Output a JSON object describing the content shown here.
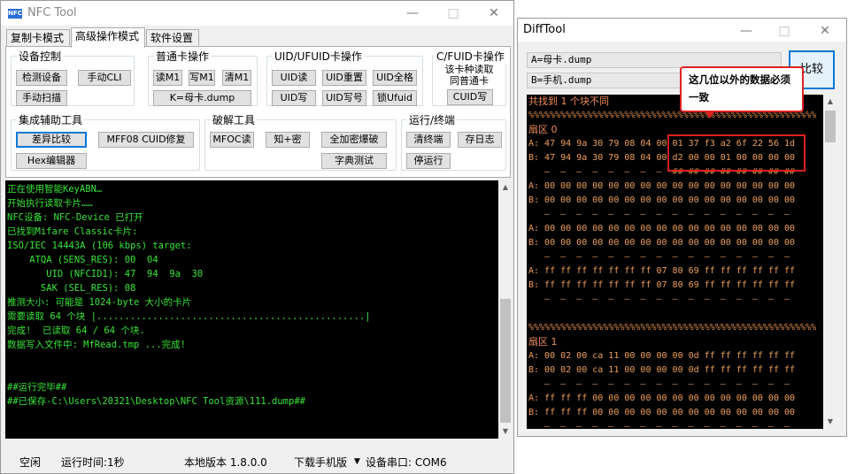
{
  "nfc": {
    "title": "NFC Tool",
    "icon_label": "NFC",
    "window_controls": [
      "—",
      "□",
      "✕"
    ],
    "tabs": [
      "复制卡模式",
      "高级操作模式",
      "软件设置"
    ],
    "groups": {
      "device": {
        "title": "设备控制",
        "buttons": [
          "检测设备",
          "手动CLI",
          "手动扫描"
        ]
      },
      "normal": {
        "title": "普通卡操作",
        "buttons": [
          "读M1",
          "写M1",
          "清M1",
          "K=母卡.dump"
        ]
      },
      "uid": {
        "title": "UID/UFUID卡操作",
        "buttons": [
          "UID读",
          "UID重置",
          "UID全格",
          "UID写",
          "UID写号",
          "锁Ufuid"
        ]
      },
      "cfuid": {
        "title": "C/FUID卡操作",
        "text_line1": "该卡种读取",
        "text_line2": "同普通卡",
        "button": "CUID写"
      },
      "integrated": {
        "title": "集成辅助工具",
        "buttons": [
          "差异比较",
          "MFF08 CUID修复",
          "Hex编辑器"
        ]
      },
      "crack": {
        "title": "破解工具",
        "buttons": [
          "MFOC读",
          "知+密",
          "全加密爆破",
          "字典测试"
        ]
      },
      "run": {
        "title": "运行/终端",
        "buttons": [
          "清终端",
          "存日志",
          "停运行"
        ]
      }
    },
    "console_lines": [
      "正在使用智能KeyABN…",
      "开始执行读取卡片……",
      "NFC设备: NFC-Device 已打开",
      "已找到Mifare Classic卡片:",
      "ISO/IEC 14443A (106 kbps) target:",
      "    ATQA (SENS_RES): 00  04",
      "       UID (NFCID1): 47  94  9a  30",
      "      SAK (SEL_RES): 08",
      "推测大小: 可能是 1024-byte 大小的卡片",
      "需要读取 64 个块 |................................................|",
      "完成!  已读取 64 / 64 个块.",
      "数据写入文件中: MfRead.tmp ...完成!",
      "",
      "",
      "##运行完毕##",
      "##已保存-C:\\Users\\20321\\Desktop\\NFC Tool资源\\111.dump##"
    ],
    "status": {
      "state": "空闲",
      "runtime": "运行时间:1秒",
      "version": "本地版本 1.8.0.0",
      "download": "下载手机版",
      "port": "设备串口: COM6"
    }
  },
  "diff": {
    "title": "DiffTool",
    "window_controls": [
      "—",
      "□",
      "✕"
    ],
    "field_a": "A=母卡.dump",
    "field_b": "B=手机.dump",
    "compare_label": "比较",
    "callout": "这几位以外的数据必须一致",
    "lines": [
      {
        "t": "共找到 1 个块不同",
        "k": "head"
      },
      {
        "t": "%%%%%%%%%%%%%%%%%%%%%%%%%%%%%%%%%%%%%%%%%%%%%%%%%%%%%%",
        "k": "sep"
      },
      {
        "t": "扇区 0",
        "k": "head"
      },
      {
        "t": "A: 47 94 9a 30 79 08 04 00 01 37 f3 a2 6f 22 56 1d",
        "k": ""
      },
      {
        "t": "B: 47 94 9a 30 79 08 04 00 d2 00 00 01 00 00 00 00",
        "k": ""
      },
      {
        "t": "   —  —  —  —  —  —  —  —  ## ## ## ## ## ## ## ##",
        "k": "sep"
      },
      {
        "t": "A: 00 00 00 00 00 00 00 00 00 00 00 00 00 00 00 00",
        "k": ""
      },
      {
        "t": "B: 00 00 00 00 00 00 00 00 00 00 00 00 00 00 00 00",
        "k": ""
      },
      {
        "t": "   —  —  —  —  —  —  —  —  —  —  —  —  —  —  —  —",
        "k": "sep"
      },
      {
        "t": "A: 00 00 00 00 00 00 00 00 00 00 00 00 00 00 00 00",
        "k": ""
      },
      {
        "t": "B: 00 00 00 00 00 00 00 00 00 00 00 00 00 00 00 00",
        "k": ""
      },
      {
        "t": "   —  —  —  —  —  —  —  —  —  —  —  —  —  —  —  —",
        "k": "sep"
      },
      {
        "t": "A: ff ff ff ff ff ff ff 07 80 69 ff ff ff ff ff ff",
        "k": ""
      },
      {
        "t": "B: ff ff ff ff ff ff ff 07 80 69 ff ff ff ff ff ff",
        "k": ""
      },
      {
        "t": "   —  —  —  —  —  —  —  —  —  —  —  —  —  —  —  —",
        "k": "sep"
      },
      {
        "t": "",
        "k": ""
      },
      {
        "t": "%%%%%%%%%%%%%%%%%%%%%%%%%%%%%%%%%%%%%%%%%%%%%%%%%%%%%%",
        "k": "sep"
      },
      {
        "t": "扇区 1",
        "k": "head"
      },
      {
        "t": "A: 00 02 00 ca 11 00 00 00 00 0d ff ff ff ff ff ff",
        "k": ""
      },
      {
        "t": "B: 00 02 00 ca 11 00 00 00 00 0d ff ff ff ff ff ff",
        "k": ""
      },
      {
        "t": "   —  —  —  —  —  —  —  —  —  —  —  —  —  —  —  —",
        "k": "sep"
      },
      {
        "t": "A: ff ff ff 00 00 00 00 00 00 00 00 00 00 00 00 00",
        "k": ""
      },
      {
        "t": "B: ff ff ff 00 00 00 00 00 00 00 00 00 00 00 00 00",
        "k": ""
      },
      {
        "t": "   —  —  —  —  —  —  —  —  —  —  —  —  —  —  —  —",
        "k": "sep"
      },
      {
        "t": "A: 00 00 00 00 00 11 00 00 40 01 00 00 00 00 00 00",
        "k": ""
      }
    ]
  }
}
